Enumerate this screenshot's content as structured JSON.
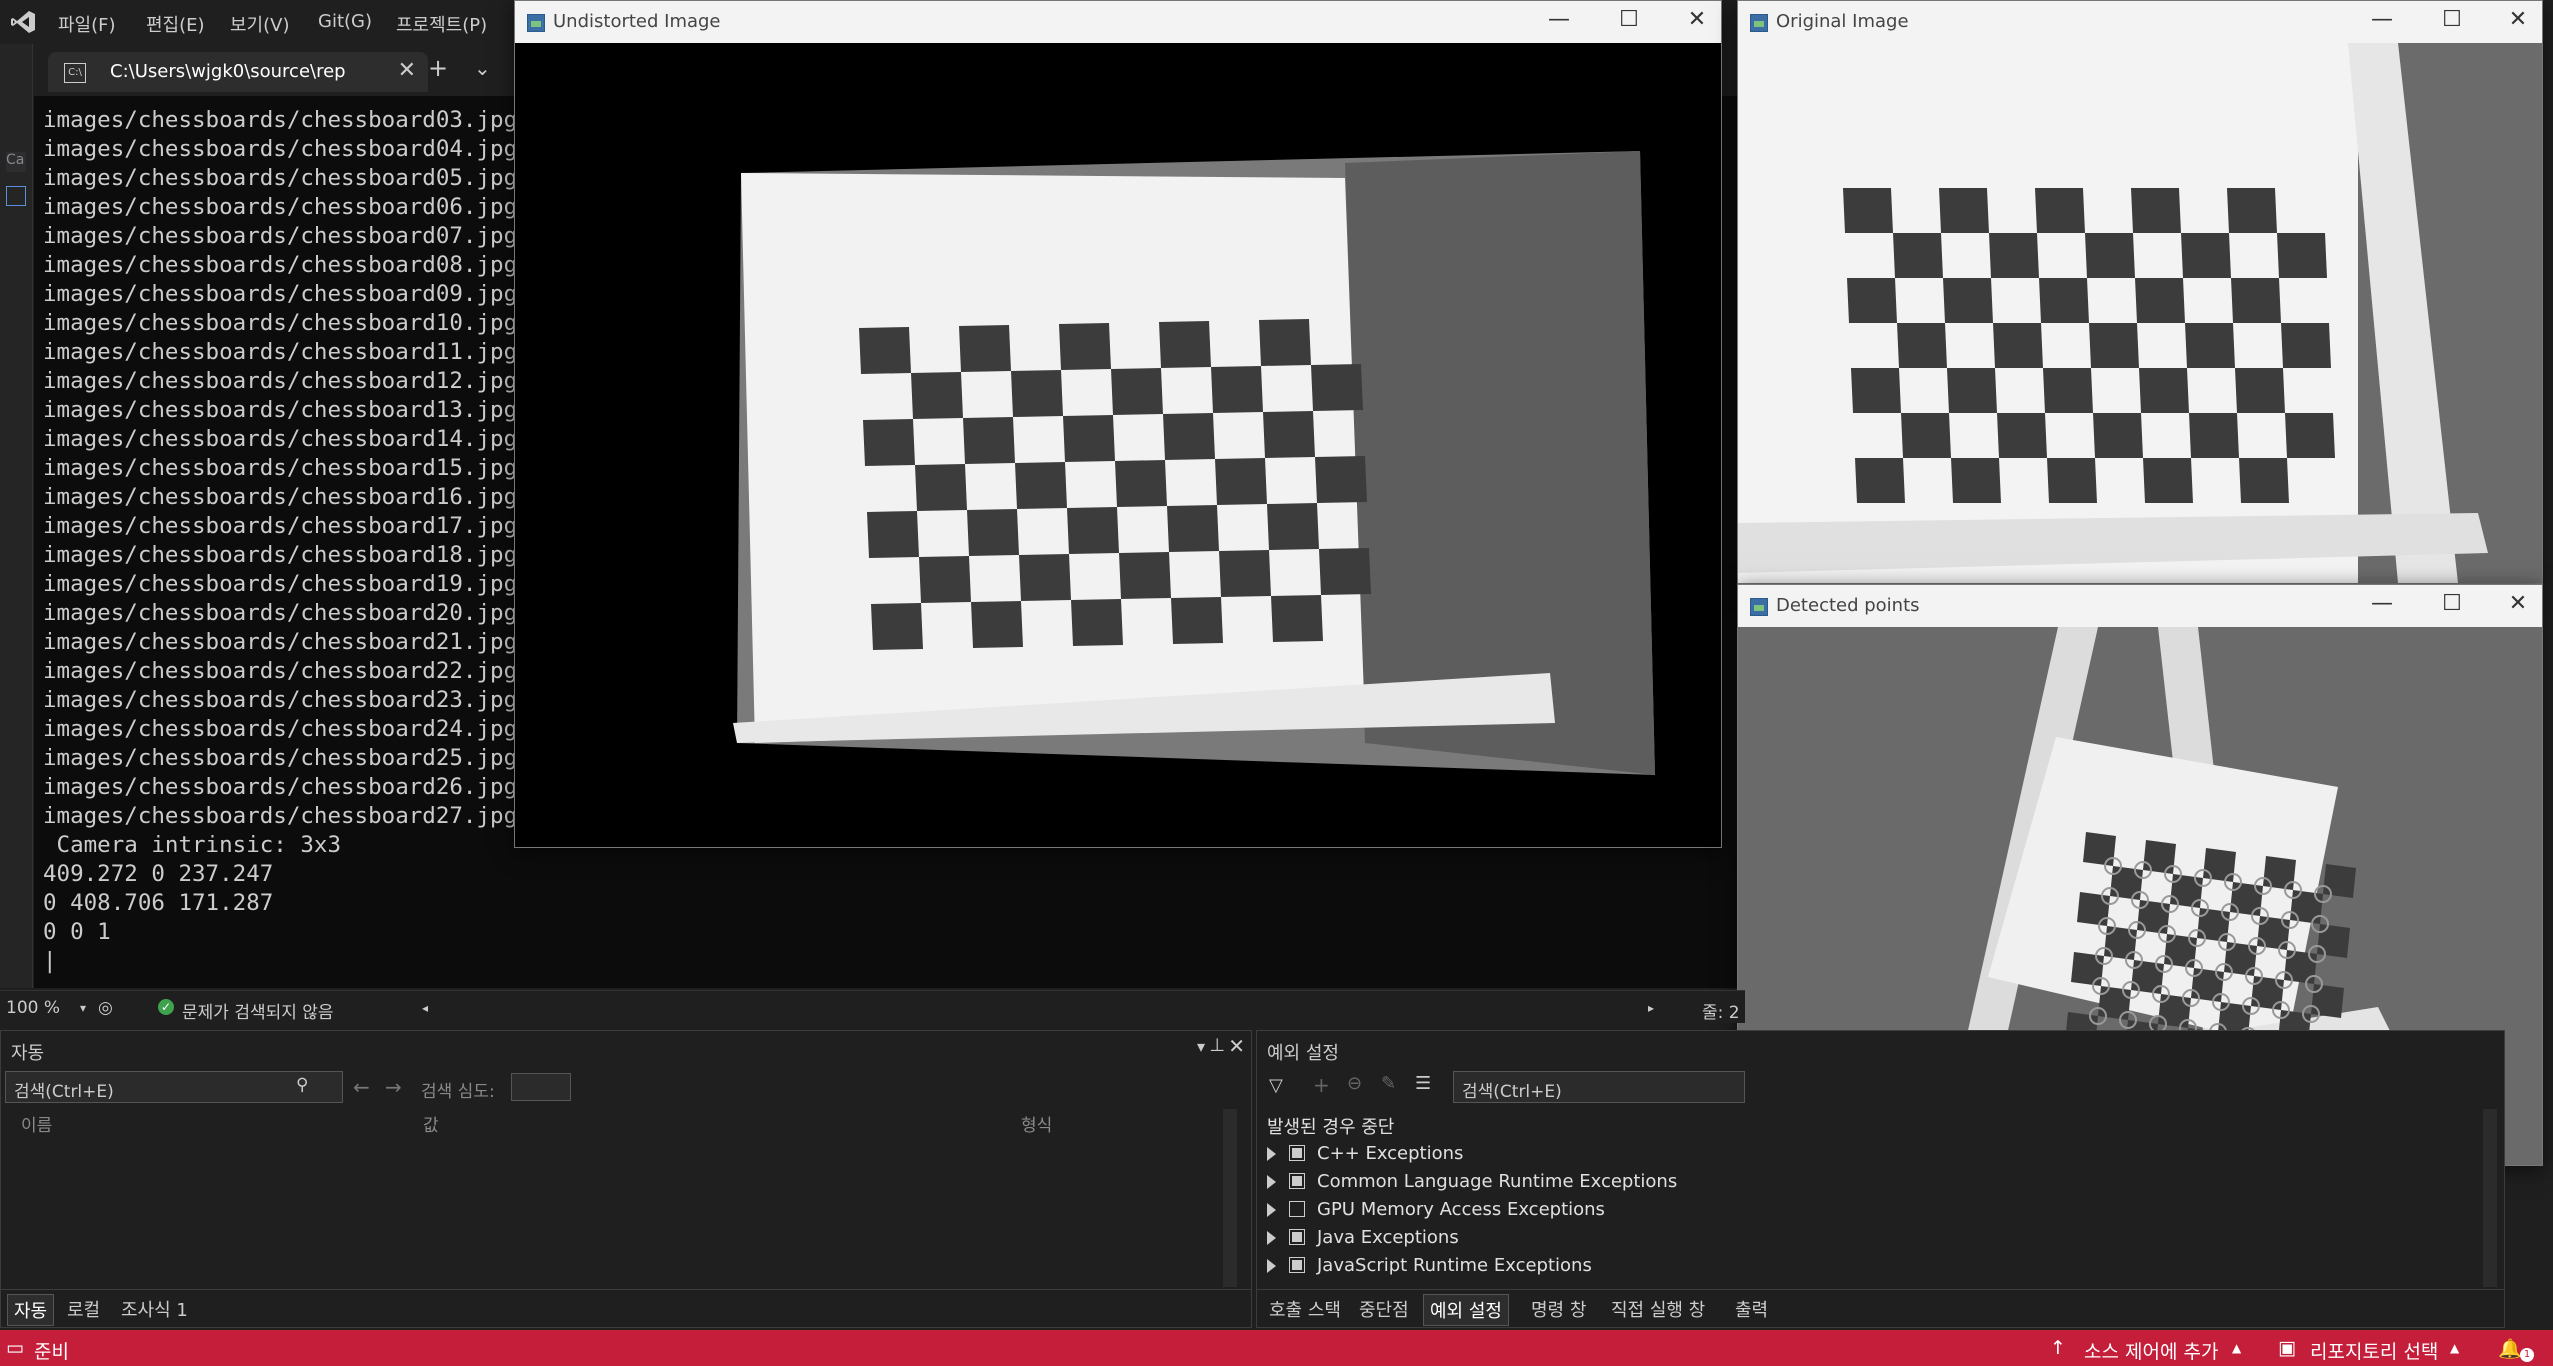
{
  "menu": {
    "items": [
      "파일(F)",
      "편집(E)",
      "보기(V)",
      "Git(G)",
      "프로젝트(P)"
    ]
  },
  "console_tab": {
    "title": "C:\\Users\\wjgk0\\source\\rep",
    "icon": "console-icon"
  },
  "console": {
    "lines": [
      "images/chessboards/chessboard03.jpg",
      "images/chessboards/chessboard04.jpg",
      "images/chessboards/chessboard05.jpg",
      "images/chessboards/chessboard06.jpg",
      "images/chessboards/chessboard07.jpg",
      "images/chessboards/chessboard08.jpg",
      "images/chessboards/chessboard09.jpg",
      "images/chessboards/chessboard10.jpg",
      "images/chessboards/chessboard11.jpg",
      "images/chessboards/chessboard12.jpg",
      "images/chessboards/chessboard13.jpg",
      "images/chessboards/chessboard14.jpg",
      "images/chessboards/chessboard15.jpg",
      "images/chessboards/chessboard16.jpg",
      "images/chessboards/chessboard17.jpg",
      "images/chessboards/chessboard18.jpg",
      "images/chessboards/chessboard19.jpg",
      "images/chessboards/chessboard20.jpg",
      "images/chessboards/chessboard21.jpg",
      "images/chessboards/chessboard22.jpg",
      "images/chessboards/chessboard23.jpg",
      "images/chessboards/chessboard24.jpg",
      "images/chessboards/chessboard25.jpg",
      "images/chessboards/chessboard26.jpg",
      "images/chessboards/chessboard27.jpg",
      " Camera intrinsic: 3x3",
      "409.272 0 237.247",
      "0 408.706 171.287",
      "0 0 1",
      "|"
    ]
  },
  "windows": {
    "undistorted": {
      "title": "Undistorted Image"
    },
    "original": {
      "title": "Original Image"
    },
    "detected": {
      "title": "Detected points"
    }
  },
  "editor_status": {
    "zoom": "100 %",
    "issues": "문제가 검색되지 않음",
    "line": "줄: 2"
  },
  "autos_panel": {
    "title": "자동",
    "search_placeholder": "검색(Ctrl+E)",
    "depth_label": "검색 심도:",
    "columns": [
      "이름",
      "값",
      "형식"
    ],
    "tabs": [
      "자동",
      "로컬",
      "조사식 1"
    ]
  },
  "exception_panel": {
    "title": "예외 설정",
    "search_placeholder": "검색(Ctrl+E)",
    "section": "발생된 경우 중단",
    "rows": [
      {
        "label": "C++ Exceptions",
        "checked": true
      },
      {
        "label": "Common Language Runtime Exceptions",
        "checked": true
      },
      {
        "label": "GPU Memory Access Exceptions",
        "checked": false
      },
      {
        "label": "Java Exceptions",
        "checked": true
      },
      {
        "label": "JavaScript Runtime Exceptions",
        "checked": true
      }
    ],
    "tabs": [
      "호출 스택",
      "중단점",
      "예외 설정",
      "명령 창",
      "직접 실행 창",
      "출력"
    ],
    "active_tab": 2
  },
  "statusbar": {
    "ready": "준비",
    "source_control": "소스 제어에 추가",
    "repo": "리포지토리 선택",
    "notifications": "1",
    "color": "#c41e3a"
  }
}
